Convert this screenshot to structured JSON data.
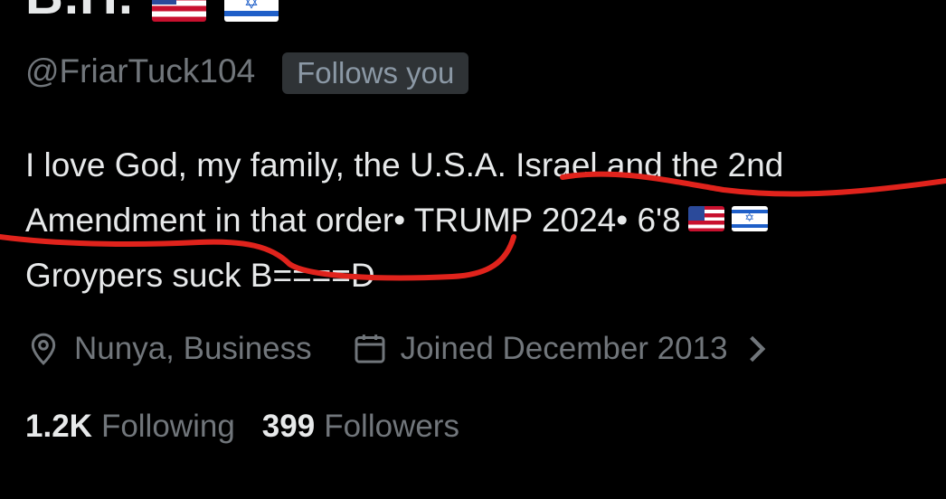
{
  "profile": {
    "display_name": "B.H.",
    "name_flags": [
      "flag-us-icon",
      "flag-il-icon"
    ],
    "handle": "@FriarTuck104",
    "follows_you_label": "Follows you",
    "bio": {
      "line1": "I love God, my family, the U.S.A. Israel and the 2nd",
      "line2": "Amendment in that order• TRUMP 2024• 6'8",
      "line3": "Groypers suck B====D"
    },
    "location": "Nunya, Business",
    "joined": "Joined December 2013",
    "following_count": "1.2K",
    "following_label": "Following",
    "followers_count": "399",
    "followers_label": "Followers"
  },
  "colors": {
    "background": "#000000",
    "text_primary": "#e7e9ea",
    "text_secondary": "#71767b",
    "badge_bg": "#2f3336",
    "annotation_red": "#e0231c"
  },
  "icons": {
    "location": "map-pin-icon",
    "joined": "calendar-icon",
    "more": "chevron-right-icon"
  }
}
